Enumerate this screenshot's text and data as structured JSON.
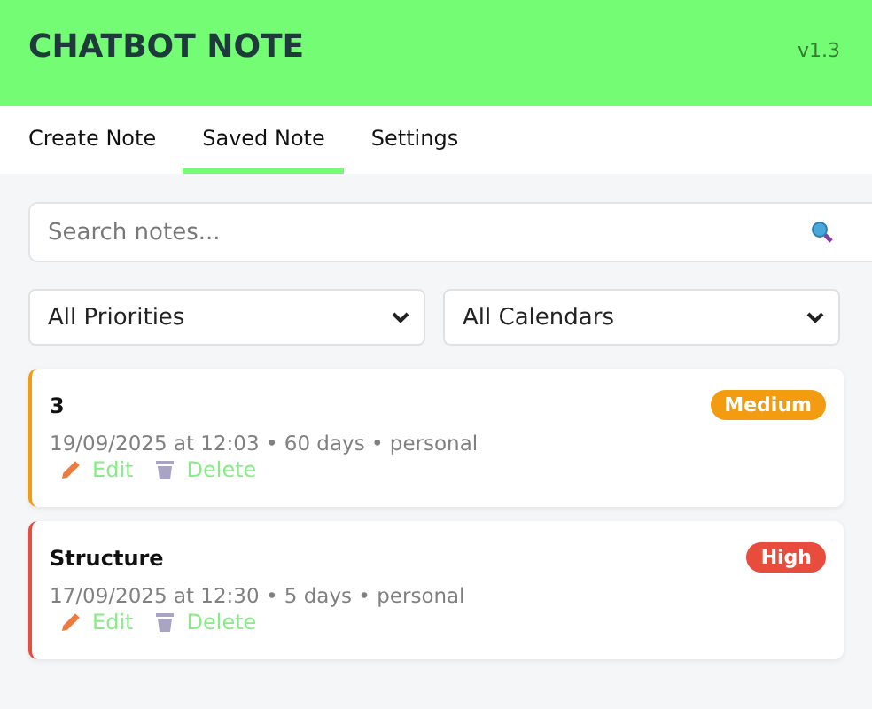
{
  "header": {
    "title": "CHATBOT NOTE",
    "version": "v1.3"
  },
  "tabs": [
    {
      "label": "Create Note",
      "selected": false
    },
    {
      "label": "Saved Note",
      "selected": true
    },
    {
      "label": "Settings",
      "selected": false
    }
  ],
  "search": {
    "placeholder": "Search notes..."
  },
  "filters": [
    {
      "value": "All Priorities"
    },
    {
      "value": "All Calendars"
    }
  ],
  "notes": [
    {
      "title": "3",
      "meta": "19/09/2025 at 12:03 • 60 days • personal",
      "priority": "Medium",
      "color": "#f39c12",
      "edit": "Edit",
      "delete": "Delete"
    },
    {
      "title": "Structure",
      "meta": "17/09/2025 at 12:30 • 5 days • personal",
      "priority": "High",
      "color": "#e74c3c",
      "edit": "Edit",
      "delete": "Delete"
    }
  ]
}
